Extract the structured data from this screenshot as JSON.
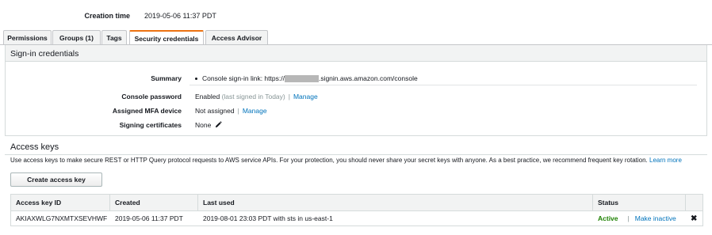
{
  "header": {
    "creation_label": "Creation time",
    "creation_value": "2019-05-06 11:37 PDT"
  },
  "tabs": [
    {
      "label": "Permissions",
      "active": false
    },
    {
      "label": "Groups (1)",
      "active": false
    },
    {
      "label": "Tags",
      "active": false
    },
    {
      "label": "Security credentials",
      "active": true
    },
    {
      "label": "Access Advisor",
      "active": false
    }
  ],
  "signin": {
    "title": "Sign-in credentials",
    "summary_label": "Summary",
    "summary_prefix": "Console sign-in link: https://",
    "summary_suffix": ".signin.aws.amazon.com/console",
    "password_label": "Console password",
    "password_status": "Enabled",
    "password_note": "(last signed in Today)",
    "password_sep": "|",
    "password_manage": "Manage",
    "mfa_label": "Assigned MFA device",
    "mfa_value": "Not assigned",
    "mfa_sep": "|",
    "mfa_manage": "Manage",
    "signing_label": "Signing certificates",
    "signing_value": "None"
  },
  "access_keys": {
    "title": "Access keys",
    "description": "Use access keys to make secure REST or HTTP Query protocol requests to AWS service APIs. For your protection, you should never share your secret keys with anyone. As a best practice, we recommend frequent key rotation.",
    "learn_more": "Learn more",
    "create_button": "Create access key",
    "columns": [
      "Access key ID",
      "Created",
      "Last used",
      "Status"
    ],
    "rows": [
      {
        "key_id": "AKIAXWLG7NXMTXSEVHWF",
        "created": "2019-05-06 11:37 PDT",
        "last_used": "2019-08-01 23:03 PDT with sts in us-east-1",
        "status": "Active",
        "status_sep": "|",
        "action": "Make inactive",
        "delete_glyph": "✖"
      }
    ]
  },
  "icons": {
    "edit": "pencil-icon",
    "delete": "close-icon"
  },
  "colors": {
    "link": "#0073bb",
    "active_status": "#1d8102",
    "tab_accent": "#ec7211"
  }
}
